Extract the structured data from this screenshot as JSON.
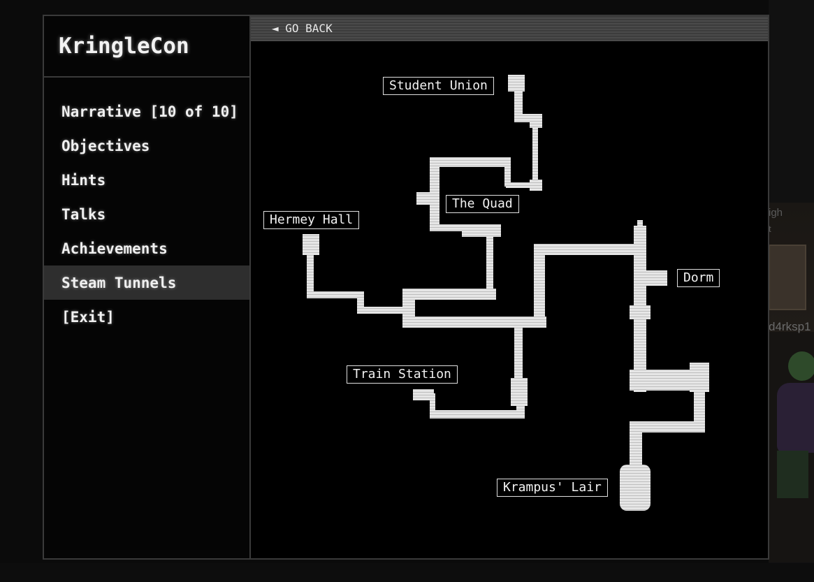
{
  "app": {
    "title": "KringleCon"
  },
  "menu": {
    "items": [
      {
        "label": "Narrative [10 of 10]"
      },
      {
        "label": "Objectives"
      },
      {
        "label": "Hints"
      },
      {
        "label": "Talks"
      },
      {
        "label": "Achievements"
      },
      {
        "label": "Steam Tunnels",
        "active": true
      },
      {
        "label": "[Exit]"
      }
    ]
  },
  "map": {
    "back_label": "◄ GO BACK",
    "locations": {
      "student_union": "Student Union",
      "the_quad": "The Quad",
      "hermey_hall": "Hermey Hall",
      "dorm": "Dorm",
      "train_station": "Train Station",
      "krampus_lair": "Krampus' Lair"
    }
  },
  "background": {
    "partial_text_1": "igh",
    "partial_text_2": "t",
    "partial_username": "d4rksp1"
  },
  "colors": {
    "tunnel": "#e2e2e2",
    "active_menu": "#2e2e2e",
    "panel_border": "#3a3a3a"
  }
}
